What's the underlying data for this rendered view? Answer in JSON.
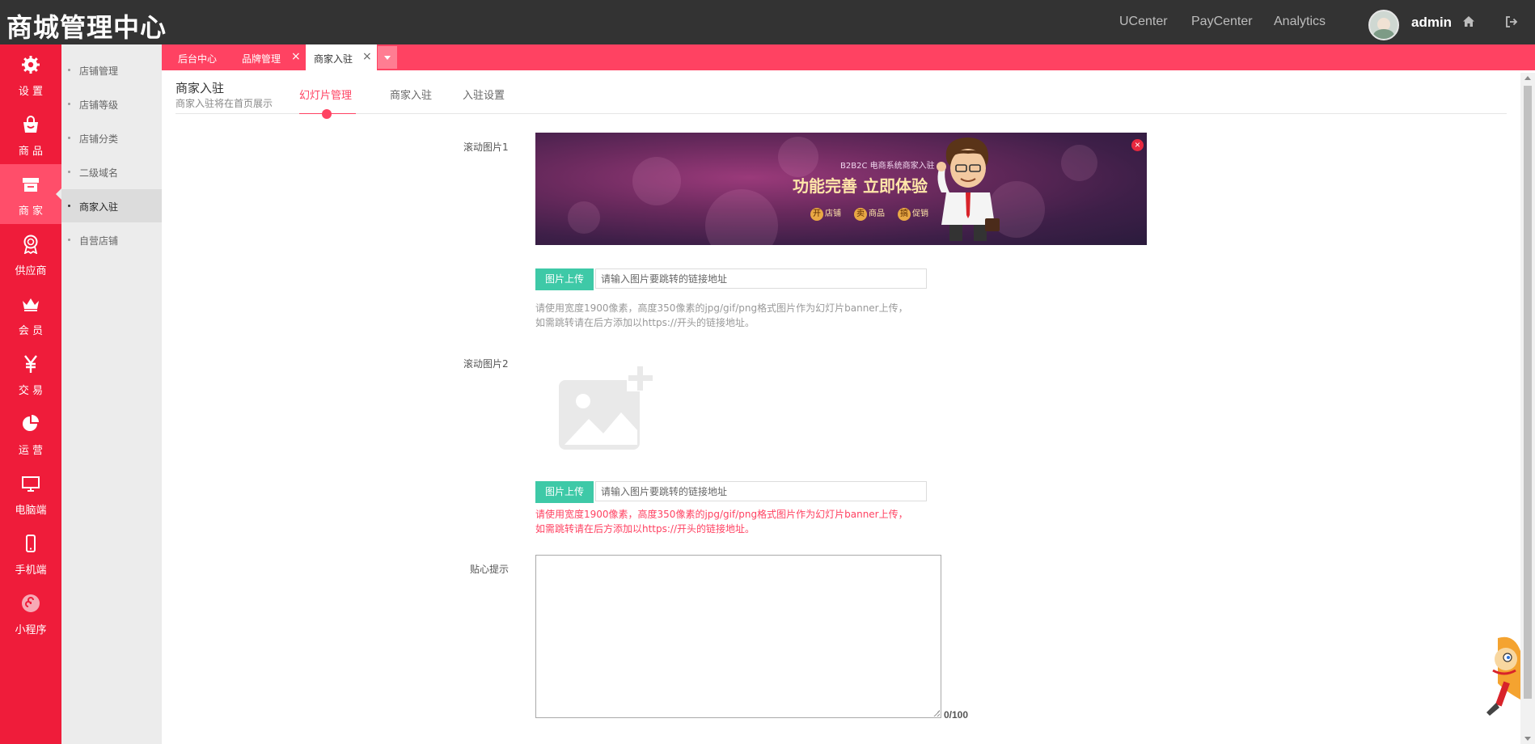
{
  "header": {
    "logo": "商城管理中心",
    "nav": [
      "UCenter",
      "PayCenter",
      "Analytics"
    ],
    "username": "admin"
  },
  "main_sidebar": [
    {
      "label": "设 置",
      "icon": "gear-icon"
    },
    {
      "label": "商 品",
      "icon": "shopping-bag-icon"
    },
    {
      "label": "商 家",
      "icon": "store-icon",
      "active": true
    },
    {
      "label": "供应商",
      "icon": "medal-icon"
    },
    {
      "label": "会 员",
      "icon": "crown-icon"
    },
    {
      "label": "交 易",
      "icon": "yen-icon"
    },
    {
      "label": "运 营",
      "icon": "pie-chart-icon"
    },
    {
      "label": "电脑端",
      "icon": "monitor-icon"
    },
    {
      "label": "手机端",
      "icon": "mobile-icon"
    },
    {
      "label": "小程序",
      "icon": "mini-program-icon"
    }
  ],
  "sub_sidebar": [
    "店铺管理",
    "店铺等级",
    "店铺分类",
    "二级域名",
    "商家入驻",
    "自营店铺"
  ],
  "sub_sidebar_active": "商家入驻",
  "tabs": [
    "后台中心",
    "品牌管理",
    "商家入驻"
  ],
  "active_tab": "商家入驻",
  "page": {
    "title": "商家入驻",
    "subtitle": "商家入驻将在首页展示",
    "subtabs": [
      "幻灯片管理",
      "商家入驻",
      "入驻设置"
    ],
    "active_subtab": "幻灯片管理"
  },
  "form": {
    "slide1_label": "滚动图片1",
    "slide2_label": "滚动图片2",
    "banner": {
      "small_text": "B2B2C 电商系统商家入驻",
      "big_text": "功能完善  立即体验",
      "chips": [
        {
          "badge": "开",
          "text": "店铺"
        },
        {
          "badge": "卖",
          "text": "商品"
        },
        {
          "badge": "搞",
          "text": "促销"
        }
      ]
    },
    "upload_label": "图片上传",
    "link_placeholder": "请输入图片要跳转的链接地址",
    "hint_line1": "请使用宽度1900像素，高度350像素的jpg/gif/png格式图片作为幻灯片banner上传，",
    "hint_line2": "如需跳转请在后方添加以https://开头的链接地址。",
    "tips_label": "贴心提示",
    "counter": "0/100"
  },
  "colors": {
    "brand_red": "#ef1c3a",
    "tab_pink": "#ff4262",
    "upload_green": "#3ec9a7",
    "topbar": "#333333"
  }
}
